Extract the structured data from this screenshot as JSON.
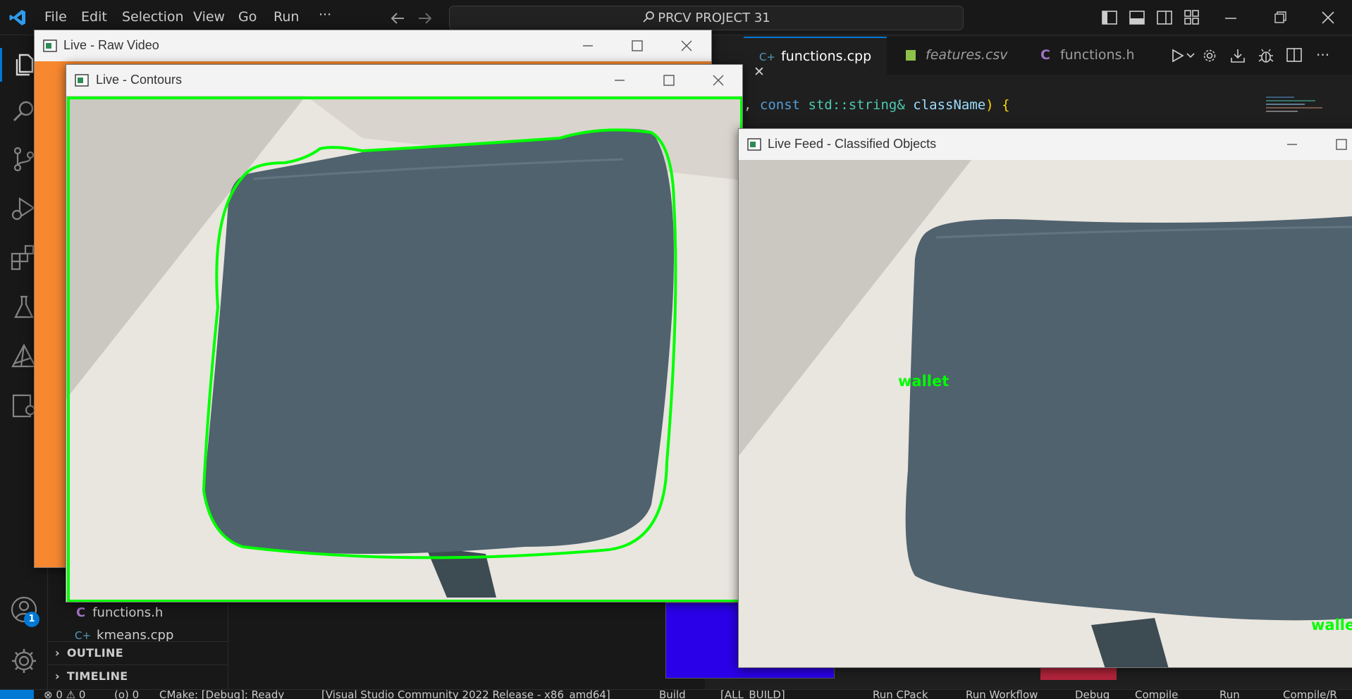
{
  "titlebar": {
    "menu": [
      "File",
      "Edit",
      "Selection",
      "View",
      "Go",
      "Run",
      "···"
    ],
    "search": "PRCV PROJECT 31"
  },
  "editor": {
    "tabs": [
      {
        "label": "functions.cpp",
        "icon": "C++"
      },
      {
        "label": "features.csv",
        "icon": "csv"
      },
      {
        "label": "functions.h",
        "icon": "C"
      }
    ],
    "code_line": {
      "prefix": ", ",
      "kw": "const",
      "type": "std::string&",
      "param": "className",
      "suffix": ") {"
    }
  },
  "sidebar": {
    "files": [
      "functions.h",
      "kmeans.cpp"
    ],
    "sections": [
      "OUTLINE",
      "TIMELINE"
    ]
  },
  "accounts_badge": "1",
  "statusbar": {
    "items": [
      "⊗ 0 ⚠ 0",
      "(o) 0",
      "CMake: [Debug]: Ready",
      "[Visual Studio Community 2022 Release - x86_amd64]",
      "Build",
      "[ALL_BUILD]",
      "Run CPack",
      "Run Workflow",
      "Debug",
      "Compile",
      "Run",
      "Compile/R"
    ]
  },
  "windows": {
    "raw_video": {
      "title": "Live - Raw Video"
    },
    "contours": {
      "title": "Live - Contours"
    },
    "classified": {
      "title": "Live Feed - Classified Objects",
      "labels": [
        "wallet",
        "wallet"
      ]
    }
  },
  "colors": {
    "accent": "#007acc",
    "contour": "#00ff00",
    "orange": "#f7882f",
    "wallet": "#4f626e"
  }
}
